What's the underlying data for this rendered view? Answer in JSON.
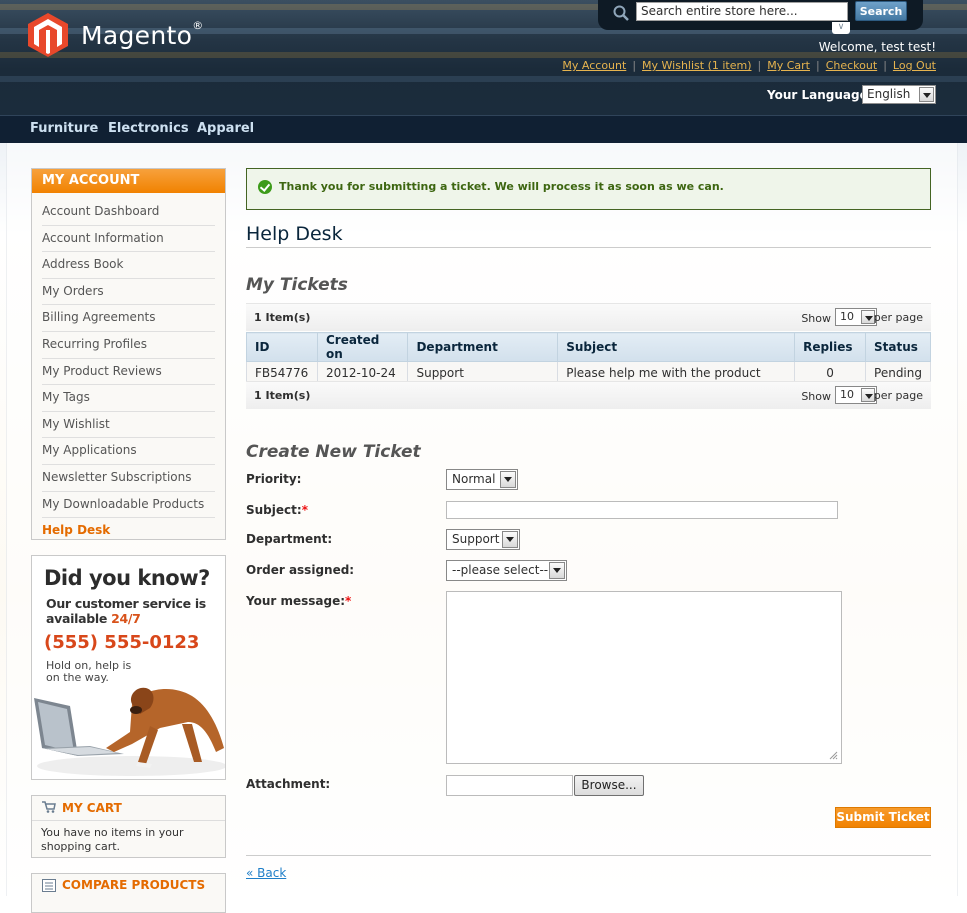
{
  "header": {
    "brand": "Magento",
    "brand_mark": "®",
    "search": {
      "placeholder": "Search entire store here...",
      "button": "Search"
    },
    "welcome": "Welcome, test test!",
    "links": [
      "My Account",
      "My Wishlist (1 item)",
      "My Cart",
      "Checkout",
      "Log Out"
    ],
    "language_label": "Your Language:",
    "language_value": "English"
  },
  "nav": [
    "Furniture",
    "Electronics",
    "Apparel"
  ],
  "sidebar": {
    "account_title": "MY ACCOUNT",
    "account_items": [
      "Account Dashboard",
      "Account Information",
      "Address Book",
      "My Orders",
      "Billing Agreements",
      "Recurring Profiles",
      "My Product Reviews",
      "My Tags",
      "My Wishlist",
      "My Applications",
      "Newsletter Subscriptions",
      "My Downloadable Products",
      "Help Desk"
    ],
    "active_item": "Help Desk",
    "promo": {
      "title": "Did you know?",
      "line1": "Our customer service is",
      "line2a": "available ",
      "line2b": "24/7",
      "phone": "(555) 555-0123",
      "hold1": "Hold on, help is",
      "hold2": "on the way."
    },
    "cart": {
      "title": "MY CART",
      "message": "You have no items in your shopping cart."
    },
    "compare": {
      "title": "COMPARE PRODUCTS"
    }
  },
  "main": {
    "success_message": "Thank you for submitting a ticket. We will process it as soon as we can.",
    "page_title": "Help Desk",
    "tickets_title": "My Tickets",
    "pager": {
      "count": "1 Item(s)",
      "show": "Show",
      "per_page": "per page",
      "limit": "10"
    },
    "table": {
      "headers": [
        "ID",
        "Created on",
        "Department",
        "Subject",
        "Replies",
        "Status"
      ],
      "rows": [
        [
          "FB54776",
          "2012-10-24",
          "Support",
          "Please help me with the product",
          "0",
          "Pending"
        ]
      ]
    },
    "form": {
      "title": "Create New Ticket",
      "priority_label": "Priority:",
      "priority_value": "Normal",
      "subject_label": "Subject:",
      "department_label": "Department:",
      "department_value": "Support",
      "order_label": "Order assigned:",
      "order_value": "--please select--",
      "message_label": "Your message:",
      "attachment_label": "Attachment:",
      "browse_label": "Browse...",
      "required_mark": "*",
      "submit_label": "Submit Ticket"
    },
    "back_link": "« Back"
  },
  "colors": {
    "accent_orange": "#f18200",
    "header_dark": "#1b2b3a",
    "link_blue": "#1e7ec8",
    "success_green": "#3d6611"
  }
}
